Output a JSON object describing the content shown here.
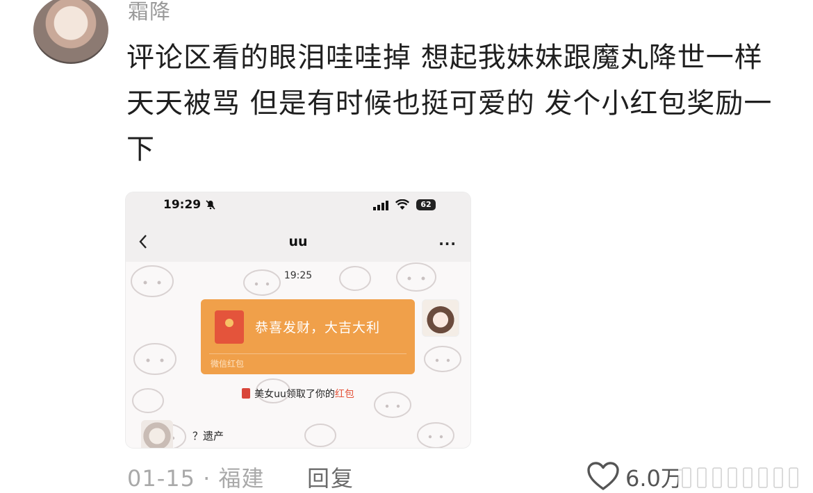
{
  "comment": {
    "username": "霜降",
    "text": "评论区看的眼泪哇哇掉 想起我妹妹跟魔丸降世一样 天天被骂 但是有时候也挺可爱的 发个小红包奖励一下",
    "date": "01-15",
    "separator": "·",
    "location": "福建",
    "reply_label": "回复",
    "like_count": "6.0万"
  },
  "screenshot": {
    "status_time": "19:29",
    "battery": "62",
    "chat_title": "uu",
    "more": "···",
    "message_time": "19:25",
    "red_packet": {
      "title": "恭喜发财，大吉大利",
      "label": "微信红包"
    },
    "system_message": {
      "prefix": "美女uu领取了你的",
      "link": "红包"
    },
    "bottom_message": "？遗产"
  },
  "colors": {
    "red_packet": "#f0a04a",
    "red_packet_icon": "#e4543b",
    "link": "#e4543b"
  }
}
